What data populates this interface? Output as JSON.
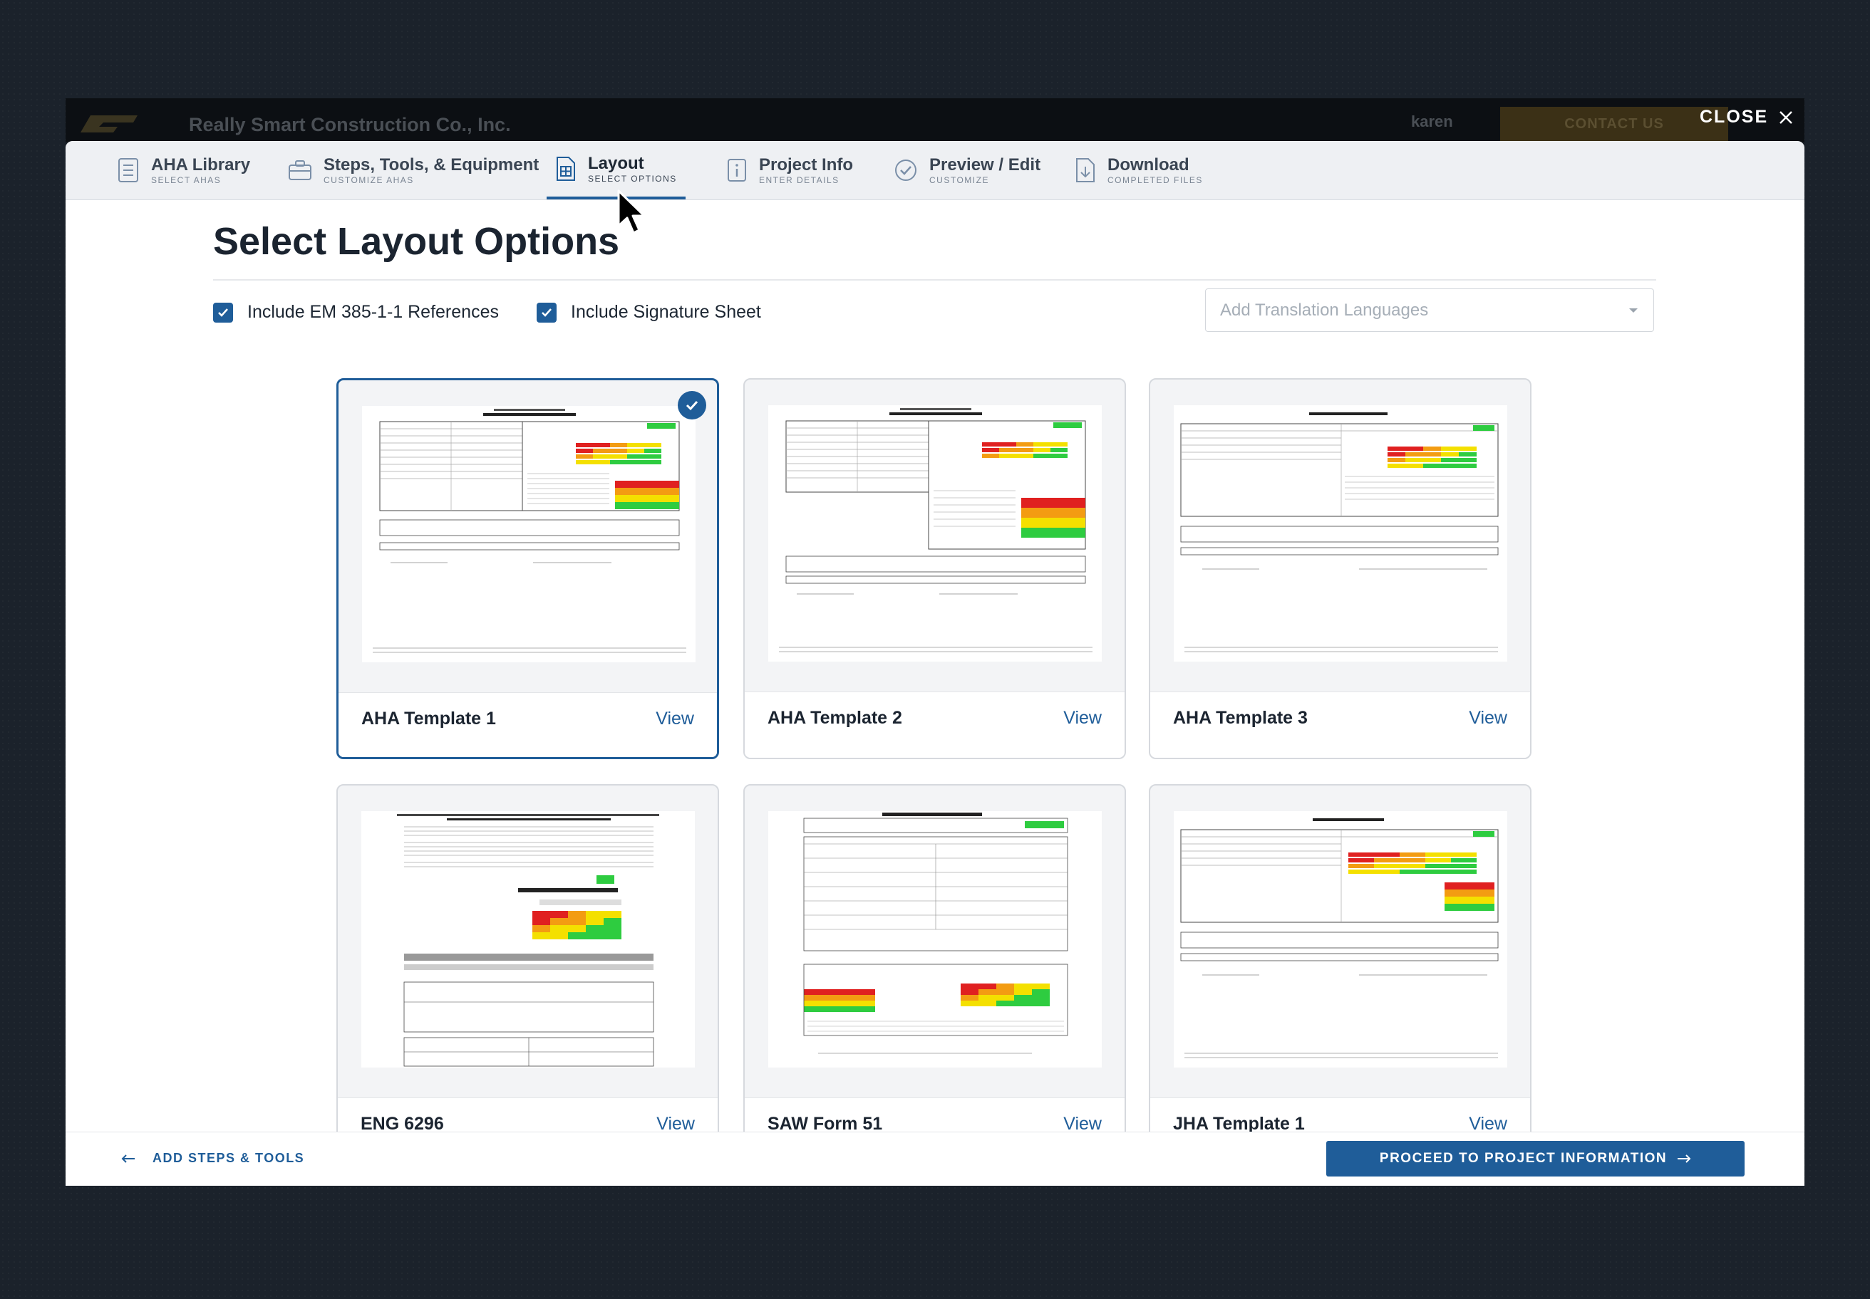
{
  "background": {
    "company": "Really Smart Construction Co., Inc.",
    "user": "karen",
    "contact": "CONTACT US"
  },
  "close_label": "CLOSE",
  "tabs": [
    {
      "label": "AHA Library",
      "sub": "SELECT AHAS",
      "icon": "list-icon"
    },
    {
      "label": "Steps, Tools, & Equipment",
      "sub": "CUSTOMIZE AHAS",
      "icon": "toolbox-icon"
    },
    {
      "label": "Layout",
      "sub": "SELECT OPTIONS",
      "icon": "document-layout-icon"
    },
    {
      "label": "Project Info",
      "sub": "ENTER DETAILS",
      "icon": "info-icon"
    },
    {
      "label": "Preview / Edit",
      "sub": "CUSTOMIZE",
      "icon": "check-circle-icon"
    },
    {
      "label": "Download",
      "sub": "COMPLETED FILES",
      "icon": "download-file-icon"
    }
  ],
  "active_tab": "Layout",
  "page_title": "Select Layout Options",
  "options": {
    "em385": {
      "label": "Include EM 385-1-1 References",
      "checked": true
    },
    "signature": {
      "label": "Include Signature Sheet",
      "checked": true
    }
  },
  "translation": {
    "placeholder": "Add Translation Languages"
  },
  "templates": [
    {
      "name": "AHA Template 1",
      "view": "View",
      "selected": true
    },
    {
      "name": "AHA Template 2",
      "view": "View",
      "selected": false
    },
    {
      "name": "AHA Template 3",
      "view": "View",
      "selected": false
    },
    {
      "name": "ENG 6296",
      "view": "View",
      "selected": false
    },
    {
      "name": "SAW Form 51",
      "view": "View",
      "selected": false
    },
    {
      "name": "JHA Template 1",
      "view": "View",
      "selected": false
    }
  ],
  "footer": {
    "back_label": "ADD STEPS & TOOLS",
    "proceed_label": "PROCEED TO PROJECT INFORMATION"
  },
  "colors": {
    "primary": "#1f5d99",
    "risk_red": "#e02020",
    "risk_orange": "#f39c12",
    "risk_yellow": "#f4e000",
    "risk_green": "#2ecc40"
  }
}
